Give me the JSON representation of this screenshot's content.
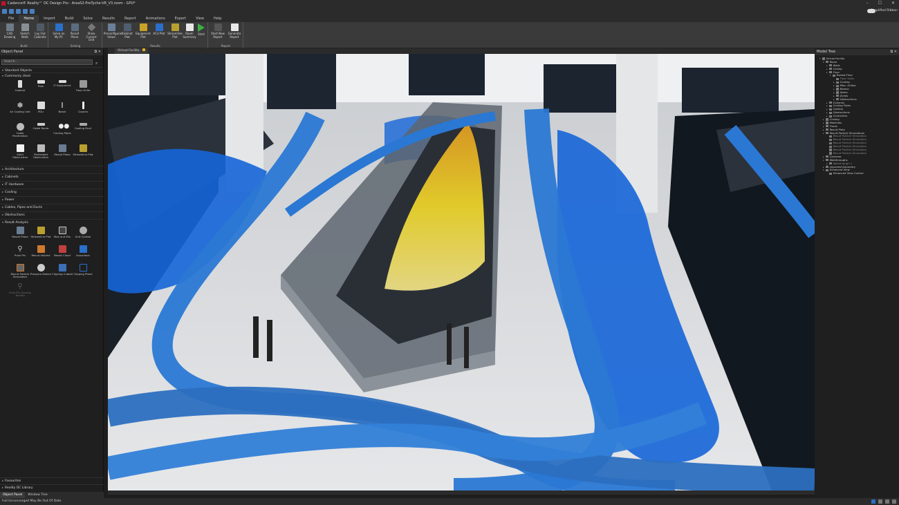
{
  "window": {
    "title": "Cadence® Reality™ DC Design Pro - AreaS2-PreTyche-VR_V3.room - GPU*",
    "controls": [
      "–",
      "☐",
      "✕"
    ]
  },
  "quick_access": {
    "simplified_ribbon_label": "Simplified Ribbon"
  },
  "ribbon_tabs": [
    "File",
    "Home",
    "Import",
    "Build",
    "Solve",
    "Results",
    "Report",
    "Animations",
    "Export",
    "View",
    "Help"
  ],
  "active_tab": "Home",
  "ribbon": {
    "build": {
      "label": "Build",
      "buttons": [
        "CAD Drawing",
        "Sketch Walls",
        "Lay Out Cabinets"
      ]
    },
    "solving": {
      "label": "Solving",
      "buttons": [
        "Solve on My PC",
        "Result Plane",
        "Show Current Grid"
      ]
    },
    "results": {
      "label": "Results",
      "buttons": [
        "Preconfigured Views",
        "Cabinet Plot",
        "Equipment Plot",
        "ACU Plot",
        "Streamline Plot",
        "Room Summary",
        "Start"
      ]
    },
    "report": {
      "label": "Report",
      "buttons": [
        "Start New Report",
        "Generate Report"
      ]
    }
  },
  "object_panel": {
    "title": "Object Panel",
    "search_placeholder": "Search...",
    "standard_objects": "Standard Objects",
    "commonly_used": "Commonly Used",
    "commonly_used_items": [
      "Cabinet",
      "Row",
      "IT Equipment",
      "Floor Grille",
      "Air Cooling Unit",
      "PDU",
      "Beam",
      "Column",
      "Cable Penetration",
      "Cable Route",
      "Cooling Pipes",
      "Cooling Duct",
      "Solid Obstruction",
      "Perforated Obstruction",
      "Result Plane",
      "Streamline Plot"
    ],
    "categories": [
      "Architecture",
      "Cabinets",
      "IT Hardware",
      "Cooling",
      "Power",
      "Cables, Pipes and Ducts",
      "Obstructions",
      "Result Analysis"
    ],
    "result_analysis_items": [
      "Result Plane",
      "Streamline Plot",
      "Max and Min",
      "Unit Control",
      "Push Pin",
      "Result Volume",
      "Result Cloud",
      "Isosurface",
      "Result Particle Simulation",
      "Pressure Datum",
      "Clipping Cuboid",
      "Clipping Plane",
      "Push Pin Overlay TechNo"
    ],
    "bottom_sections": [
      "Favourites",
      "Reality DC Library"
    ]
  },
  "bottom_tabs": [
    "Object Panel",
    "Window Tree"
  ],
  "status": {
    "text": "Full Unconverged May Be Out Of Date"
  },
  "view_tab": {
    "label": "Virtual Facility"
  },
  "colors": {
    "accent": "#2a6fc9",
    "airflow_blue": "#1565d8",
    "heat_yellow": "#f2d21a",
    "cable_blue": "#2a78d4"
  },
  "model_tree": {
    "title": "Model Tree",
    "nodes": [
      {
        "label": "Virtual Facility",
        "level": 0,
        "arrow": "▾"
      },
      {
        "label": "Room",
        "level": 1,
        "arrow": "▾"
      },
      {
        "label": "Walls",
        "level": 2,
        "arrow": "▸",
        "italic": true
      },
      {
        "label": "Ceiling",
        "level": 2,
        "arrow": "▸",
        "italic": true
      },
      {
        "label": "Floor",
        "level": 2,
        "arrow": "▾",
        "italic": true
      },
      {
        "label": "Raised Floor",
        "level": 3,
        "arrow": "▾",
        "italic": true
      },
      {
        "label": "Floor Voids",
        "level": 4,
        "arrow": "",
        "dim": true
      },
      {
        "label": "Cooling",
        "level": 4,
        "arrow": "▸",
        "italic": true
      },
      {
        "label": "Misc. Grilles",
        "level": 4,
        "arrow": "▸",
        "italic": true
      },
      {
        "label": "Beams",
        "level": 4,
        "arrow": "▸",
        "italic": true
      },
      {
        "label": "Aisles",
        "level": 4,
        "arrow": "▸",
        "italic": true
      },
      {
        "label": "Zones",
        "level": 4,
        "arrow": "▸",
        "italic": true
      },
      {
        "label": "Obstructions",
        "level": 4,
        "arrow": "▸",
        "italic": true
      },
      {
        "label": "Columns",
        "level": 2,
        "arrow": "▸",
        "italic": true
      },
      {
        "label": "Cooling Pipes",
        "level": 2,
        "arrow": "▸",
        "italic": true
      },
      {
        "label": "Cabling",
        "level": 2,
        "arrow": "▸",
        "italic": true
      },
      {
        "label": "Obstructions",
        "level": 2,
        "arrow": "▸",
        "italic": true
      },
      {
        "label": "Controllers",
        "level": 2,
        "arrow": "▸",
        "italic": true
      },
      {
        "label": "Cooling",
        "level": 1,
        "arrow": "▸",
        "italic": true
      },
      {
        "label": "Materials",
        "level": 1,
        "arrow": "▸",
        "italic": true
      },
      {
        "label": "Fluids",
        "level": 1,
        "arrow": "▸"
      },
      {
        "label": "Result Plots",
        "level": 1,
        "arrow": "▸"
      },
      {
        "label": "Result Particle Simulations",
        "level": 1,
        "arrow": "▾"
      },
      {
        "label": "Result Particle Simulation",
        "level": 2,
        "arrow": "",
        "dim": true
      },
      {
        "label": "Result Particle Simulation",
        "level": 2,
        "arrow": "",
        "dim": true
      },
      {
        "label": "Result Particle Simulation",
        "level": 2,
        "arrow": "",
        "dim": true
      },
      {
        "label": "Result Particle Simulation",
        "level": 2,
        "arrow": "",
        "dim": true
      },
      {
        "label": "Result Particle Simulation",
        "level": 2,
        "arrow": "",
        "dim": true
      },
      {
        "label": "Result Particle Simulation",
        "level": 2,
        "arrow": "",
        "dim": true
      },
      {
        "label": "Cameras",
        "level": 1,
        "arrow": "▸",
        "italic": true
      },
      {
        "label": "Walkthroughs",
        "level": 1,
        "arrow": "▾"
      },
      {
        "label": "Walkthrough 1",
        "level": 2,
        "arrow": "▸",
        "dim": true
      },
      {
        "label": "Imported Geometry",
        "level": 1,
        "arrow": "▸",
        "italic": true
      },
      {
        "label": "Enhanced View",
        "level": 1,
        "arrow": "▾",
        "italic": true
      },
      {
        "label": "Enhanced View Control",
        "level": 2,
        "arrow": ""
      }
    ]
  }
}
